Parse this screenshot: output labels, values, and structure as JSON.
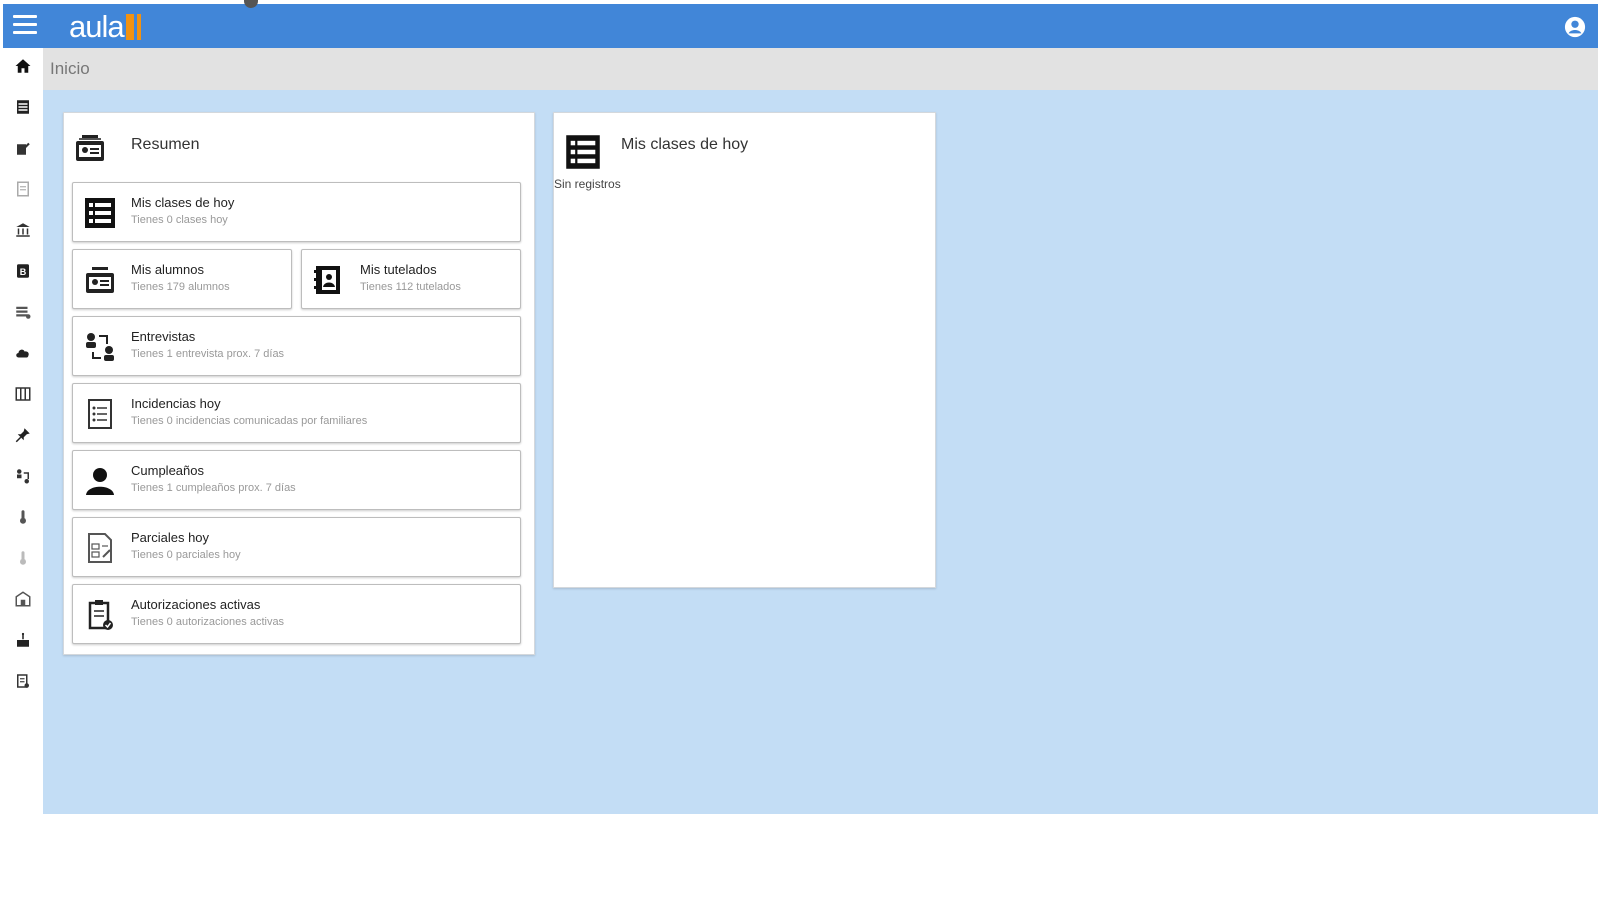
{
  "header": {
    "logo_text": "aula",
    "menu_icon": "hamburger-icon",
    "user_icon": "user-circle-icon",
    "brand_color": "#4186d8",
    "accent_color": "#f29211"
  },
  "breadcrumb": {
    "label": "Inicio"
  },
  "sidebar": {
    "items": [
      {
        "icon": "home-icon"
      },
      {
        "icon": "calendar-icon"
      },
      {
        "icon": "edit-icon"
      },
      {
        "icon": "document-icon"
      },
      {
        "icon": "bank-icon"
      },
      {
        "icon": "book-icon"
      },
      {
        "icon": "list-icon"
      },
      {
        "icon": "cloud-icon"
      },
      {
        "icon": "columns-icon"
      },
      {
        "icon": "pin-icon"
      },
      {
        "icon": "swap-icon"
      },
      {
        "icon": "thermometer-icon"
      },
      {
        "icon": "marker-icon"
      },
      {
        "icon": "building-icon"
      },
      {
        "icon": "cake-icon"
      },
      {
        "icon": "clipboard-icon"
      }
    ]
  },
  "resumen": {
    "title": "Resumen",
    "cards": [
      {
        "title": "Mis clases de hoy",
        "subtitle": "Tienes 0 clases hoy"
      },
      {
        "title": "Mis alumnos",
        "subtitle": "Tienes 179 alumnos"
      },
      {
        "title": "Mis tutelados",
        "subtitle": "Tienes 112 tutelados"
      },
      {
        "title": "Entrevistas",
        "subtitle": "Tienes 1 entrevista prox. 7 días"
      },
      {
        "title": "Incidencias hoy",
        "subtitle": "Tienes 0 incidencias comunicadas por familiares"
      },
      {
        "title": "Cumpleaños",
        "subtitle": "Tienes 1 cumpleaños prox. 7 días"
      },
      {
        "title": "Parciales hoy",
        "subtitle": "Tienes 0 parciales hoy"
      },
      {
        "title": "Autorizaciones activas",
        "subtitle": "Tienes 0 autorizaciones activas"
      }
    ]
  },
  "clases_panel": {
    "title": "Mis clases de hoy",
    "empty_text": "Sin registros"
  }
}
